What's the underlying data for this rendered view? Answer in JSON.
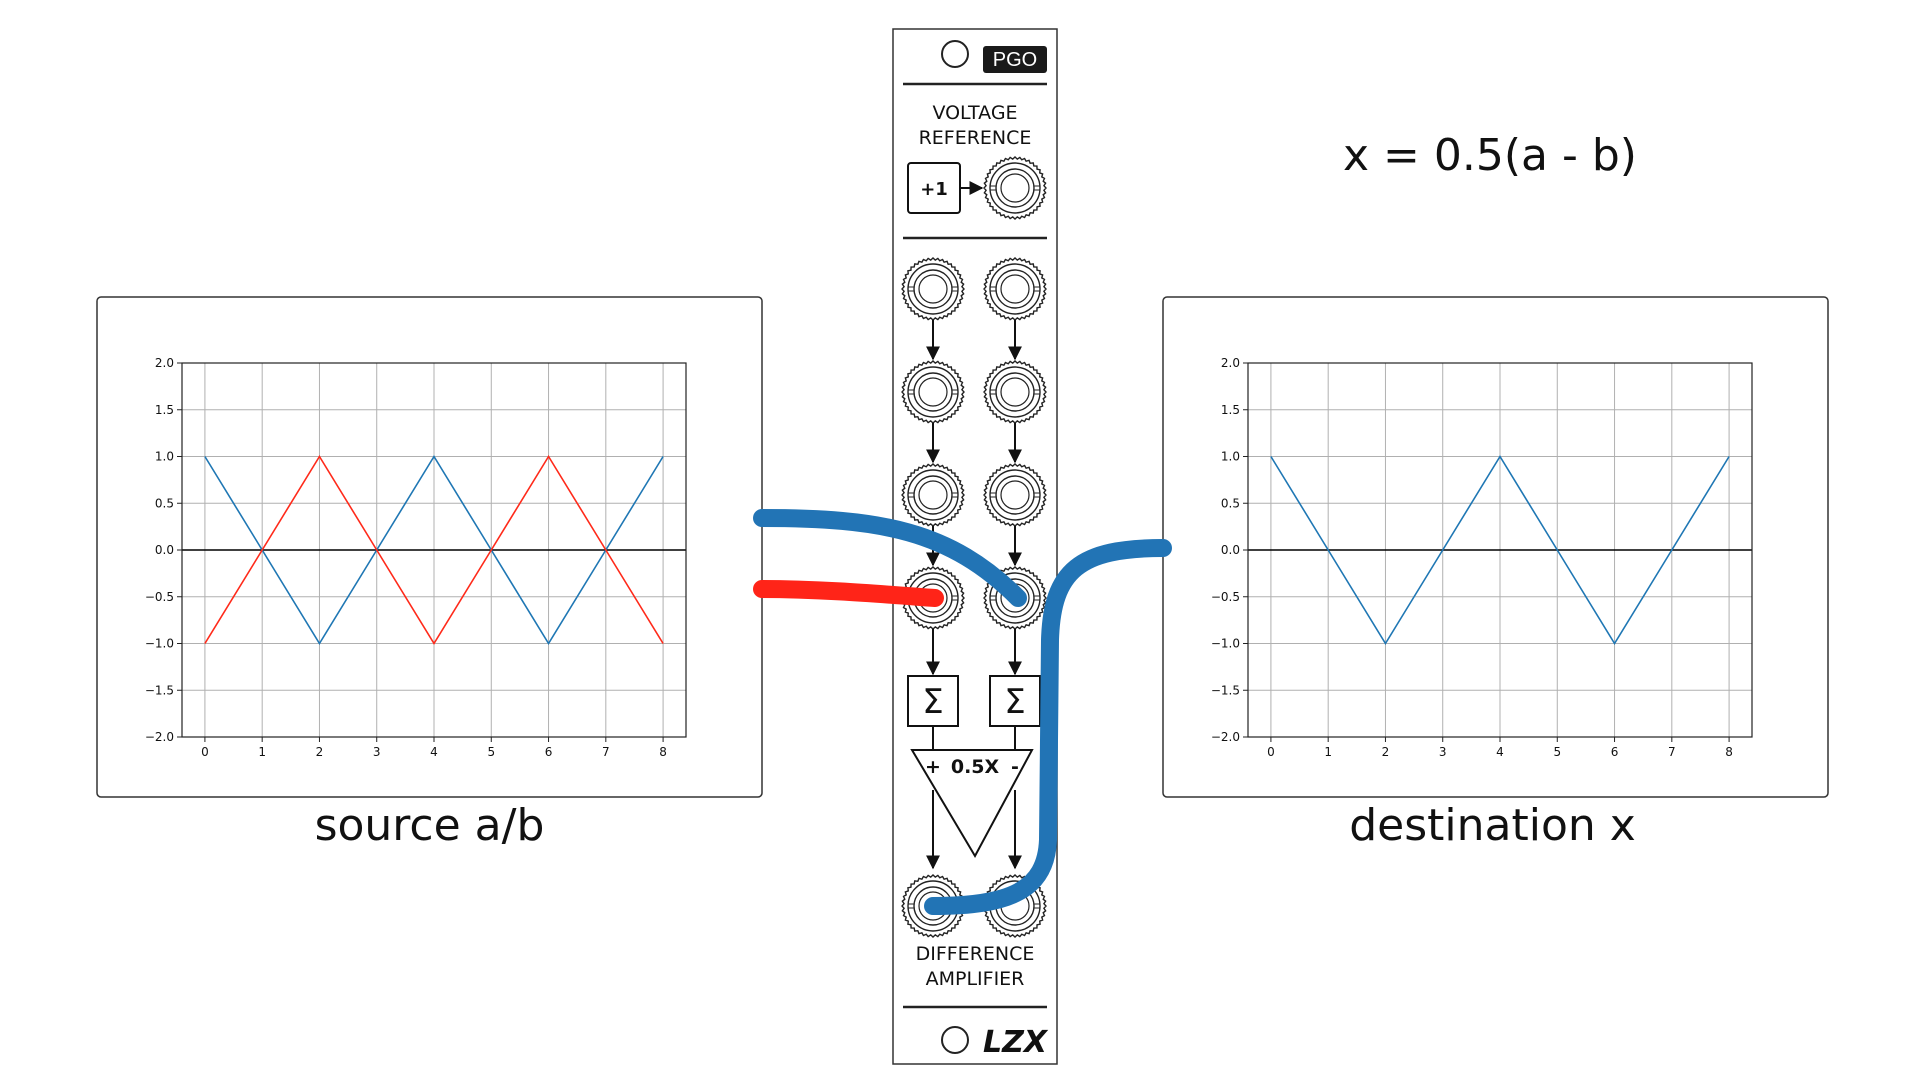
{
  "captions": {
    "source": "source a/b",
    "destination": "destination x",
    "formula": "x = 0.5(a - b)"
  },
  "module": {
    "badge": "PGO",
    "section1_line1": "VOLTAGE",
    "section1_line2": "REFERENCE",
    "ref_box": "+1",
    "amp_label_plus": "+",
    "amp_label_gain": "0.5X",
    "amp_label_minus": "-",
    "sum_symbol": "Σ",
    "section2_line1": "DIFFERENCE",
    "section2_line2": "AMPLIFIER",
    "logo": "LZX"
  },
  "colors": {
    "blue": "#1f77b4",
    "red": "#ff2a1a",
    "cable_blue": "#2274b5",
    "cable_red": "#ff2418"
  },
  "chart_data": [
    {
      "name": "source",
      "type": "line",
      "xlim": [
        -0.4,
        8.4
      ],
      "ylim": [
        -2.0,
        2.0
      ],
      "xticks": [
        "0",
        "1",
        "2",
        "3",
        "4",
        "5",
        "6",
        "7",
        "8"
      ],
      "yticks": [
        "2.0",
        "1.5",
        "1.0",
        "0.5",
        "0.0",
        "−0.5",
        "−1.0",
        "−1.5",
        "−2.0"
      ],
      "grid": true,
      "series": [
        {
          "color": "#1f77b4",
          "x": [
            0,
            1,
            2,
            3,
            4,
            5,
            6,
            7,
            8
          ],
          "y": [
            1,
            0,
            -1,
            0,
            1,
            0,
            -1,
            0,
            1
          ]
        },
        {
          "color": "#ff2a1a",
          "x": [
            0,
            1,
            2,
            3,
            4,
            5,
            6,
            7,
            8
          ],
          "y": [
            -1,
            0,
            1,
            0,
            -1,
            0,
            1,
            0,
            -1
          ]
        }
      ]
    },
    {
      "name": "destination",
      "type": "line",
      "xlim": [
        -0.4,
        8.4
      ],
      "ylim": [
        -2.0,
        2.0
      ],
      "xticks": [
        "0",
        "1",
        "2",
        "3",
        "4",
        "5",
        "6",
        "7",
        "8"
      ],
      "yticks": [
        "2.0",
        "1.5",
        "1.0",
        "0.5",
        "0.0",
        "−0.5",
        "−1.0",
        "−1.5",
        "−2.0"
      ],
      "grid": true,
      "series": [
        {
          "color": "#1f77b4",
          "x": [
            0,
            1,
            2,
            3,
            4,
            5,
            6,
            7,
            8
          ],
          "y": [
            1,
            0,
            -1,
            0,
            1,
            0,
            -1,
            0,
            1
          ]
        }
      ]
    }
  ]
}
